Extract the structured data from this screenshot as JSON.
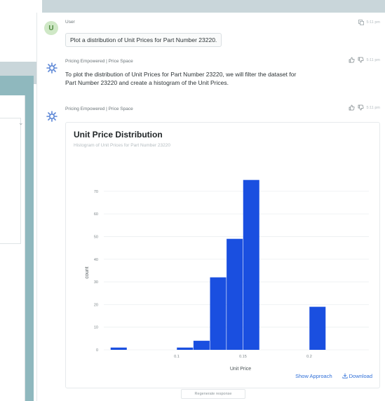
{
  "left_panel": {
    "glyph": "⌄"
  },
  "messages": [
    {
      "sender": "User",
      "avatar_letter": "U",
      "time": "5:11 pm",
      "text": "Plot a distribution of Unit Prices for Part Number 23220.",
      "icons": [
        "copy-icon"
      ]
    },
    {
      "sender": "Pricing Empowered | Price Space",
      "time": "5:11 pm",
      "text_line1": "To plot the distribution of Unit Prices for Part Number 23220, we will filter the dataset for",
      "text_line2": "Part Number 23220 and create a histogram of the Unit Prices.",
      "icons": [
        "thumbs-up-icon",
        "thumbs-down-icon"
      ]
    },
    {
      "sender": "Pricing Empowered | Price Space",
      "time": "5:11 pm",
      "icons": [
        "thumbs-up-icon",
        "thumbs-down-icon"
      ]
    }
  ],
  "chart_actions": {
    "show_approach": "Show Approach",
    "download": "Download"
  },
  "regenerate_label": "Regenerate response",
  "colors": {
    "bar": "#1a4fe0",
    "accent_link": "#2f6fd8"
  },
  "chart_data": {
    "type": "bar",
    "title": "Unit Price Distribution",
    "subtitle": "Histogram of Unit Prices for Part Number 23220",
    "xlabel": "Unit Price",
    "ylabel": "count",
    "xlim": [
      0.045,
      0.245
    ],
    "ylim": [
      0,
      78
    ],
    "yticks": [
      0,
      10,
      20,
      30,
      40,
      50,
      60,
      70
    ],
    "xticks": [
      0.1,
      0.15,
      0.2
    ],
    "xtick_labels": [
      "0.1",
      "0.15",
      "0.2"
    ],
    "bins": [
      {
        "x0": 0.05,
        "x1": 0.0625,
        "count": 1
      },
      {
        "x0": 0.0625,
        "x1": 0.075,
        "count": 0
      },
      {
        "x0": 0.075,
        "x1": 0.0875,
        "count": 0
      },
      {
        "x0": 0.0875,
        "x1": 0.1,
        "count": 0
      },
      {
        "x0": 0.1,
        "x1": 0.1125,
        "count": 1
      },
      {
        "x0": 0.1125,
        "x1": 0.125,
        "count": 4
      },
      {
        "x0": 0.125,
        "x1": 0.1375,
        "count": 32
      },
      {
        "x0": 0.1375,
        "x1": 0.15,
        "count": 49
      },
      {
        "x0": 0.15,
        "x1": 0.1625,
        "count": 75
      },
      {
        "x0": 0.1625,
        "x1": 0.175,
        "count": 0
      },
      {
        "x0": 0.175,
        "x1": 0.1875,
        "count": 0
      },
      {
        "x0": 0.1875,
        "x1": 0.2,
        "count": 0
      },
      {
        "x0": 0.2,
        "x1": 0.2125,
        "count": 19
      }
    ],
    "grid": true,
    "legend": "none"
  }
}
